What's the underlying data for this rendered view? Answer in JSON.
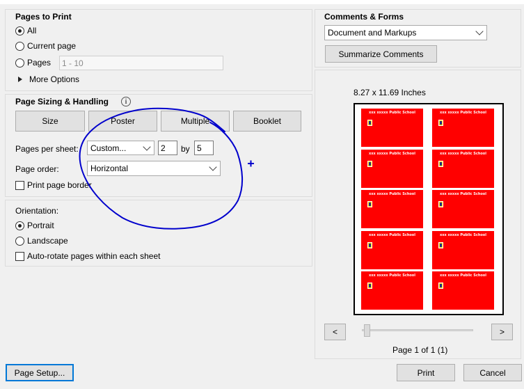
{
  "pages_to_print": {
    "title": "Pages to Print",
    "all_label": "All",
    "current_page_label": "Current page",
    "pages_label": "Pages",
    "pages_value": "1 - 10",
    "more_options_label": "More Options",
    "selected": "All"
  },
  "page_sizing": {
    "title": "Page Sizing & Handling",
    "info_glyph": "i",
    "tabs": [
      "Size",
      "Poster",
      "Multiple",
      "Booklet"
    ],
    "pages_per_sheet_label": "Pages per sheet:",
    "pages_per_sheet_value": "Custom...",
    "cols_value": "2",
    "by_label": "by",
    "rows_value": "5",
    "page_order_label": "Page order:",
    "page_order_value": "Horizontal",
    "print_border_label": "Print page border",
    "print_border_checked": false
  },
  "orientation": {
    "title": "Orientation:",
    "portrait_label": "Portrait",
    "landscape_label": "Landscape",
    "selected": "Portrait",
    "auto_rotate_label": "Auto-rotate pages within each sheet",
    "auto_rotate_checked": false
  },
  "comments_forms": {
    "title": "Comments & Forms",
    "select_value": "Document and Markups",
    "summarize_label": "Summarize Comments"
  },
  "preview": {
    "size_label": "8.27 x 11.69 Inches",
    "tile_text": "xxx xxxxx Public School",
    "tile_color": "#ff0000",
    "prev_label": "<",
    "next_label": ">",
    "page_info": "Page 1 of 1 (1)",
    "page_position": 0
  },
  "footer": {
    "page_setup_label": "Page Setup...",
    "print_label": "Print",
    "cancel_label": "Cancel"
  },
  "annotation": {
    "color": "#0000cc",
    "plus_glyph": "+"
  }
}
